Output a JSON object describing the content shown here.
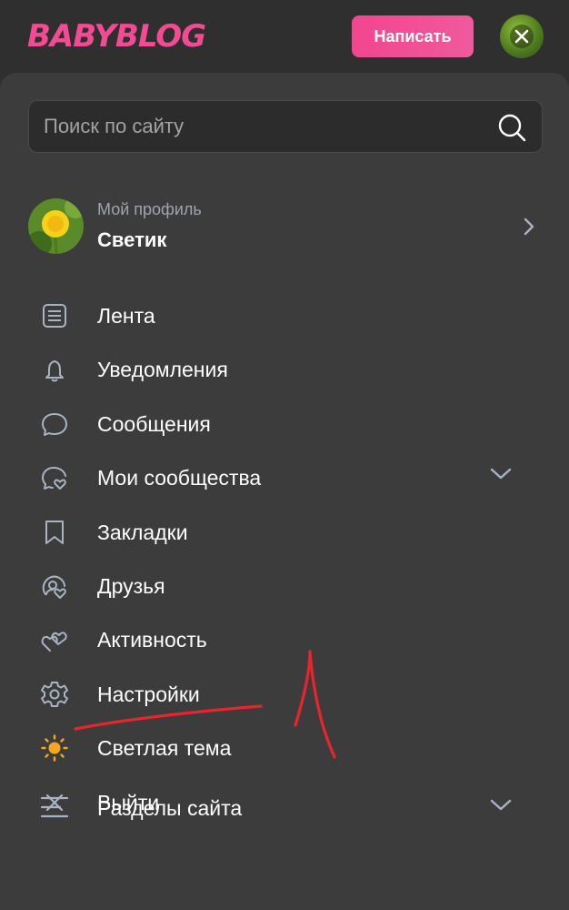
{
  "header": {
    "logo_text": "BABYBLOG",
    "write_button": "Написать",
    "close_icon": "close-icon"
  },
  "search": {
    "placeholder": "Поиск по сайту",
    "value": "",
    "icon": "search-icon"
  },
  "profile": {
    "subtitle": "Мой профиль",
    "name": "Светик",
    "avatar": "dandelion-avatar"
  },
  "menu": {
    "items": [
      {
        "label": "Лента",
        "icon": "feed-icon"
      },
      {
        "label": "Уведомления",
        "icon": "bell-icon"
      },
      {
        "label": "Сообщения",
        "icon": "chat-bubble-icon"
      },
      {
        "label": "Мои сообщества",
        "icon": "community-icon",
        "expandable": true
      },
      {
        "label": "Закладки",
        "icon": "bookmark-icon"
      },
      {
        "label": "Друзья",
        "icon": "friends-icon"
      },
      {
        "label": "Активность",
        "icon": "hearts-icon"
      },
      {
        "label": "Настройки",
        "icon": "gear-icon"
      },
      {
        "label": "Светлая тема",
        "icon": "sun-icon"
      },
      {
        "label": "Выйти",
        "icon": "close-icon"
      }
    ]
  },
  "sections": {
    "label": "Разделы сайта",
    "icon": "menu-lines-icon"
  },
  "colors": {
    "brand_pink": "#f34b93",
    "panel_bg": "#3c3c3d",
    "icon_gray": "#aab3c2",
    "sun_orange": "#f6a623",
    "annotation_red": "#e8242d"
  }
}
